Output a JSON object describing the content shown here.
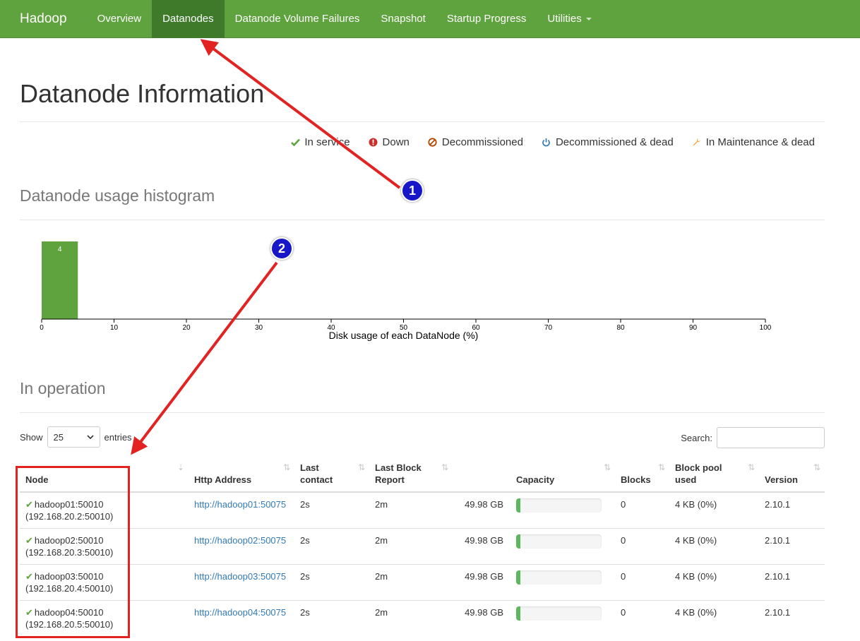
{
  "navbar": {
    "brand": "Hadoop",
    "items": [
      {
        "label": "Overview"
      },
      {
        "label": "Datanodes"
      },
      {
        "label": "Datanode Volume Failures"
      },
      {
        "label": "Snapshot"
      },
      {
        "label": "Startup Progress"
      },
      {
        "label": "Utilities"
      }
    ]
  },
  "page_title": "Datanode Information",
  "legend": [
    {
      "label": "In service",
      "icon": "check-icon",
      "color": "#5fa33e"
    },
    {
      "label": "Down",
      "icon": "exclamation-circle-icon",
      "color": "#d9534f"
    },
    {
      "label": "Decommissioned",
      "icon": "ban-icon",
      "color": "#b34700"
    },
    {
      "label": "Decommissioned & dead",
      "icon": "power-icon",
      "color": "#337ab7"
    },
    {
      "label": "In Maintenance & dead",
      "icon": "wrench-icon",
      "color": "#f0ad4e"
    }
  ],
  "histogram_title": "Datanode usage histogram",
  "chart_data": {
    "type": "bar",
    "bins": [
      [
        0,
        5
      ]
    ],
    "values": [
      4
    ],
    "x_ticks": [
      "0",
      "10",
      "20",
      "30",
      "40",
      "50",
      "60",
      "70",
      "80",
      "90",
      "100"
    ],
    "xlabel": "Disk usage of each DataNode (%)",
    "xlim": [
      0,
      100
    ],
    "bar_color": "#5fa33e"
  },
  "operation_title": "In operation",
  "table_controls": {
    "show_label": "Show",
    "page_size": "25",
    "entries_label": "entries",
    "search_label": "Search:"
  },
  "table": {
    "headers": {
      "node": "Node",
      "http": "Http Address",
      "last_contact_1": "Last",
      "last_contact_2": "contact",
      "last_block_1": "Last Block",
      "last_block_2": "Report",
      "capacity": "Capacity",
      "blocks": "Blocks",
      "pool_1": "Block pool",
      "pool_2": "used",
      "version": "Version"
    },
    "rows": [
      {
        "node": "hadoop01:50010",
        "ip": "(192.168.20.2:50010)",
        "http": "http://hadoop01:50075",
        "last_contact": "2s",
        "last_block": "2m",
        "capacity": "49.98 GB",
        "usage": 0.05,
        "blocks": "0",
        "pool": "4 KB (0%)",
        "version": "2.10.1"
      },
      {
        "node": "hadoop02:50010",
        "ip": "(192.168.20.3:50010)",
        "http": "http://hadoop02:50075",
        "last_contact": "2s",
        "last_block": "2m",
        "capacity": "49.98 GB",
        "usage": 0.05,
        "blocks": "0",
        "pool": "4 KB (0%)",
        "version": "2.10.1"
      },
      {
        "node": "hadoop03:50010",
        "ip": "(192.168.20.4:50010)",
        "http": "http://hadoop03:50075",
        "last_contact": "2s",
        "last_block": "2m",
        "capacity": "49.98 GB",
        "usage": 0.05,
        "blocks": "0",
        "pool": "4 KB (0%)",
        "version": "2.10.1"
      },
      {
        "node": "hadoop04:50010",
        "ip": "(192.168.20.5:50010)",
        "http": "http://hadoop04:50075",
        "last_contact": "2s",
        "last_block": "2m",
        "capacity": "49.98 GB",
        "usage": 0.05,
        "blocks": "0",
        "pool": "4 KB (0%)",
        "version": "2.10.1"
      }
    ]
  },
  "annotations": {
    "badge_1": "1",
    "badge_2": "2",
    "color": "#e32222"
  }
}
